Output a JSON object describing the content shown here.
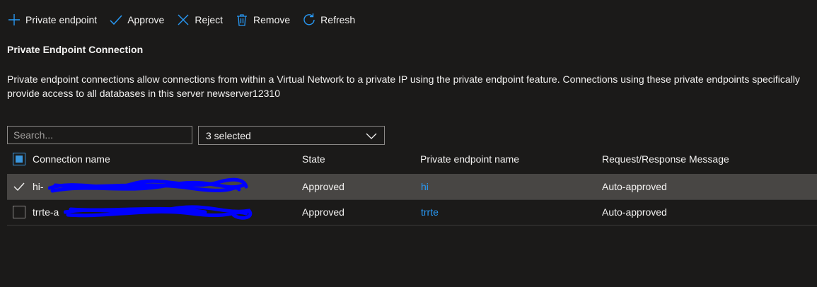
{
  "toolbar": {
    "private_endpoint": "Private endpoint",
    "approve": "Approve",
    "reject": "Reject",
    "remove": "Remove",
    "refresh": "Refresh"
  },
  "section": {
    "title": "Private Endpoint Connection",
    "description_line1": "Private endpoint connections allow connections from within a Virtual Network to a private IP using the private endpoint feature. Connections using these private endpoints specifically",
    "description_line2": "provide access to all databases in this server newserver12310"
  },
  "filters": {
    "search_placeholder": "Search...",
    "search_value": "",
    "state_filter": "3 selected"
  },
  "table": {
    "columns": [
      "Connection name",
      "State",
      "Private endpoint name",
      "Request/Response Message"
    ],
    "rows": [
      {
        "connection_name": "hi-",
        "state": "Approved",
        "endpoint": "hi",
        "message": "Auto-approved",
        "selected": true
      },
      {
        "connection_name": "trrte-a",
        "state": "Approved",
        "endpoint": "trrte",
        "message": "Auto-approved",
        "selected": false
      }
    ]
  },
  "colors": {
    "background": "#1b1a19",
    "accent": "#0078d4",
    "link": "#2899f5",
    "selected_row": "#484644",
    "redaction": "#0000ff"
  }
}
